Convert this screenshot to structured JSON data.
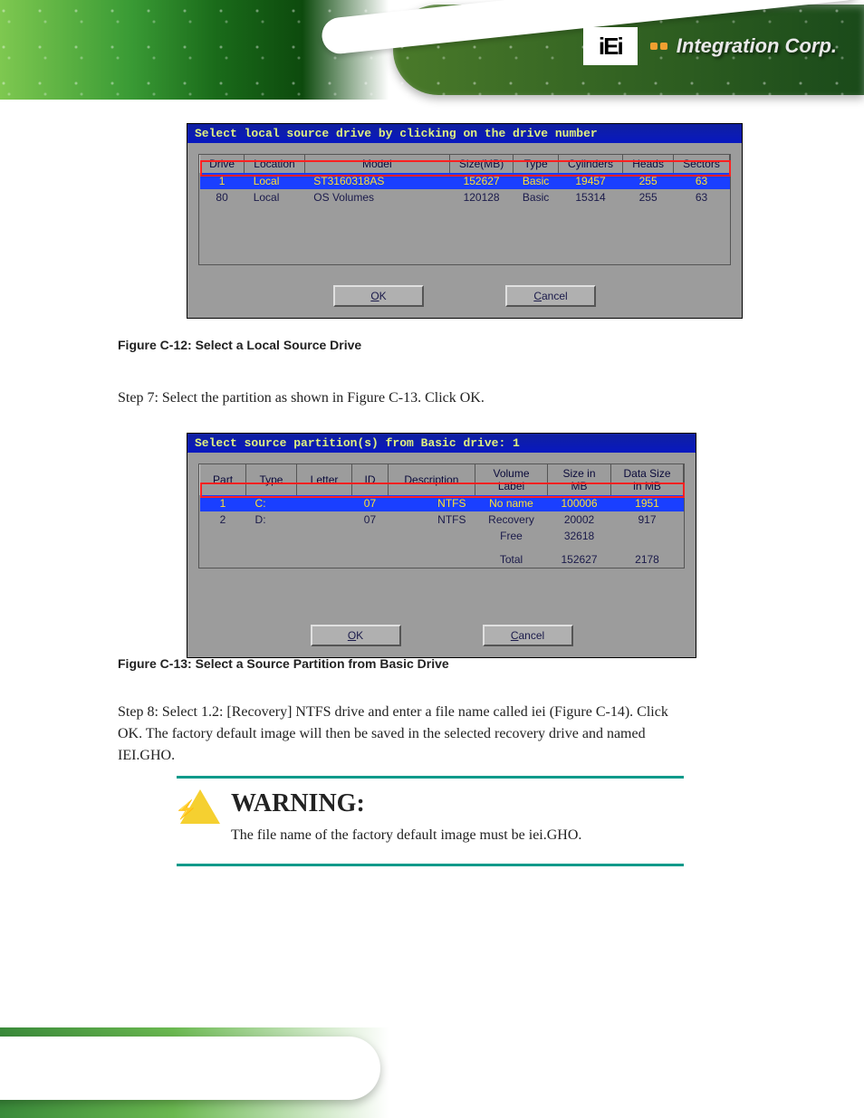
{
  "logo": {
    "mark": "iEi",
    "text": "Integration Corp."
  },
  "dialog1": {
    "title": "Select local source drive by clicking on the drive number",
    "headers": [
      "Drive",
      "Location",
      "Model",
      "Size(MB)",
      "Type",
      "Cylinders",
      "Heads",
      "Sectors"
    ],
    "rows": [
      {
        "drive": "1",
        "location": "Local",
        "model": "ST3160318AS",
        "size": "152627",
        "type": "Basic",
        "cyl": "19457",
        "heads": "255",
        "sectors": "63"
      },
      {
        "drive": "80",
        "location": "Local",
        "model": "OS Volumes",
        "size": "120128",
        "type": "Basic",
        "cyl": "15314",
        "heads": "255",
        "sectors": "63"
      }
    ],
    "ok": "OK",
    "cancel": "Cancel"
  },
  "caption1": "Figure C-12: Select a Local Source Drive",
  "step7": "Step 7:  Select the partition as shown in Figure C-13. Click OK.",
  "dialog2": {
    "title": "Select source partition(s) from Basic drive: 1",
    "headers": [
      "Part",
      "Type",
      "Letter",
      "ID",
      "Description",
      "Volume Label",
      "Size in MB",
      "Data Size in MB"
    ],
    "rows": [
      {
        "part": "1",
        "type": "C:",
        "letter": "",
        "id": "07",
        "desc": "NTFS",
        "label": "No name",
        "size": "100006",
        "data": "1951"
      },
      {
        "part": "2",
        "type": "D:",
        "letter": "",
        "id": "07",
        "desc": "NTFS",
        "label": "Recovery",
        "size": "20002",
        "data": "917"
      }
    ],
    "free_label": "Free",
    "free_size": "32618",
    "total_label": "Total",
    "total_size": "152627",
    "total_data": "2178",
    "ok": "OK",
    "cancel": "Cancel"
  },
  "caption2": "Figure C-13: Select a Source Partition from Basic Drive",
  "step8": "Step 8:  Select 1.2: [Recovery] NTFS drive and enter a file name called iei (Figure C-14). Click OK. The factory default image will then be saved in the selected recovery drive and named IEI.GHO.",
  "warning": {
    "title": "WARNING:",
    "text": "The file name of the factory default image must be iei.GHO."
  }
}
